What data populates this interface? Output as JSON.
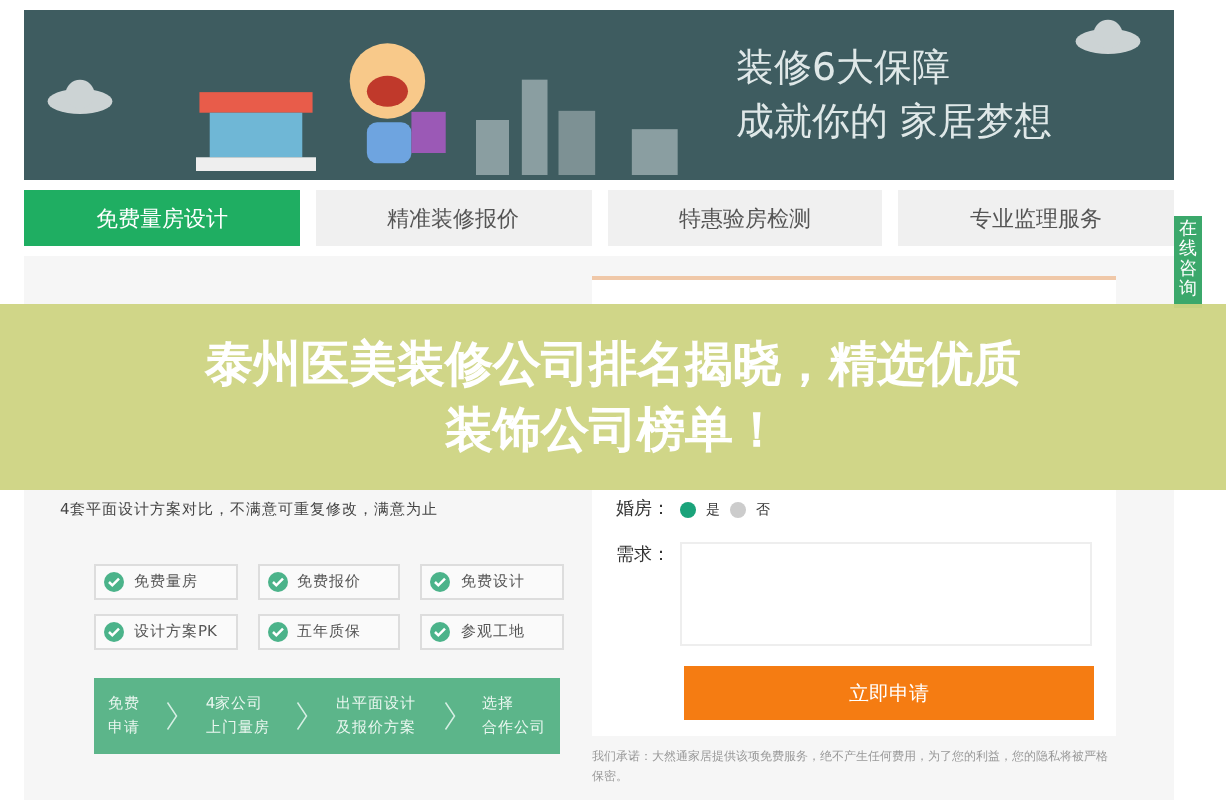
{
  "banner": {
    "line1": "装修6大保障",
    "line2": "成就你的 家居梦想"
  },
  "tabs": [
    {
      "label": "免费量房设计",
      "selected": true
    },
    {
      "label": "精准装修报价",
      "selected": false
    },
    {
      "label": "特惠验房检测",
      "selected": false
    },
    {
      "label": "专业监理服务",
      "selected": false
    }
  ],
  "side_tab": {
    "label": "在线咨询"
  },
  "promo": {
    "desc": [
      "4套平面设计方案对比，不满意可重复修改，满意为止"
    ],
    "features": [
      "免费量房",
      "免费报价",
      "免费设计",
      "设计方案PK",
      "五年质保",
      "参观工地"
    ],
    "steps": [
      [
        "免费",
        "申请"
      ],
      [
        "4家公司",
        "上门量房"
      ],
      [
        "出平面设计",
        "及报价方案"
      ],
      [
        "选择",
        "合作公司"
      ]
    ]
  },
  "form": {
    "wedding_label": "婚房：",
    "options": [
      {
        "label": "是",
        "selected": true
      },
      {
        "label": "否",
        "selected": false
      }
    ],
    "need_label": "需求：",
    "submit": "立即申请",
    "note": "我们承诺：大然通家居提供该项免费服务，绝不产生任何费用，为了您的利益，您的隐私将被严格保密。"
  },
  "overlay": {
    "title_line1": "泰州医美装修公司排名揭晓，精选优质",
    "title_line2": "装饰公司榜单！"
  }
}
